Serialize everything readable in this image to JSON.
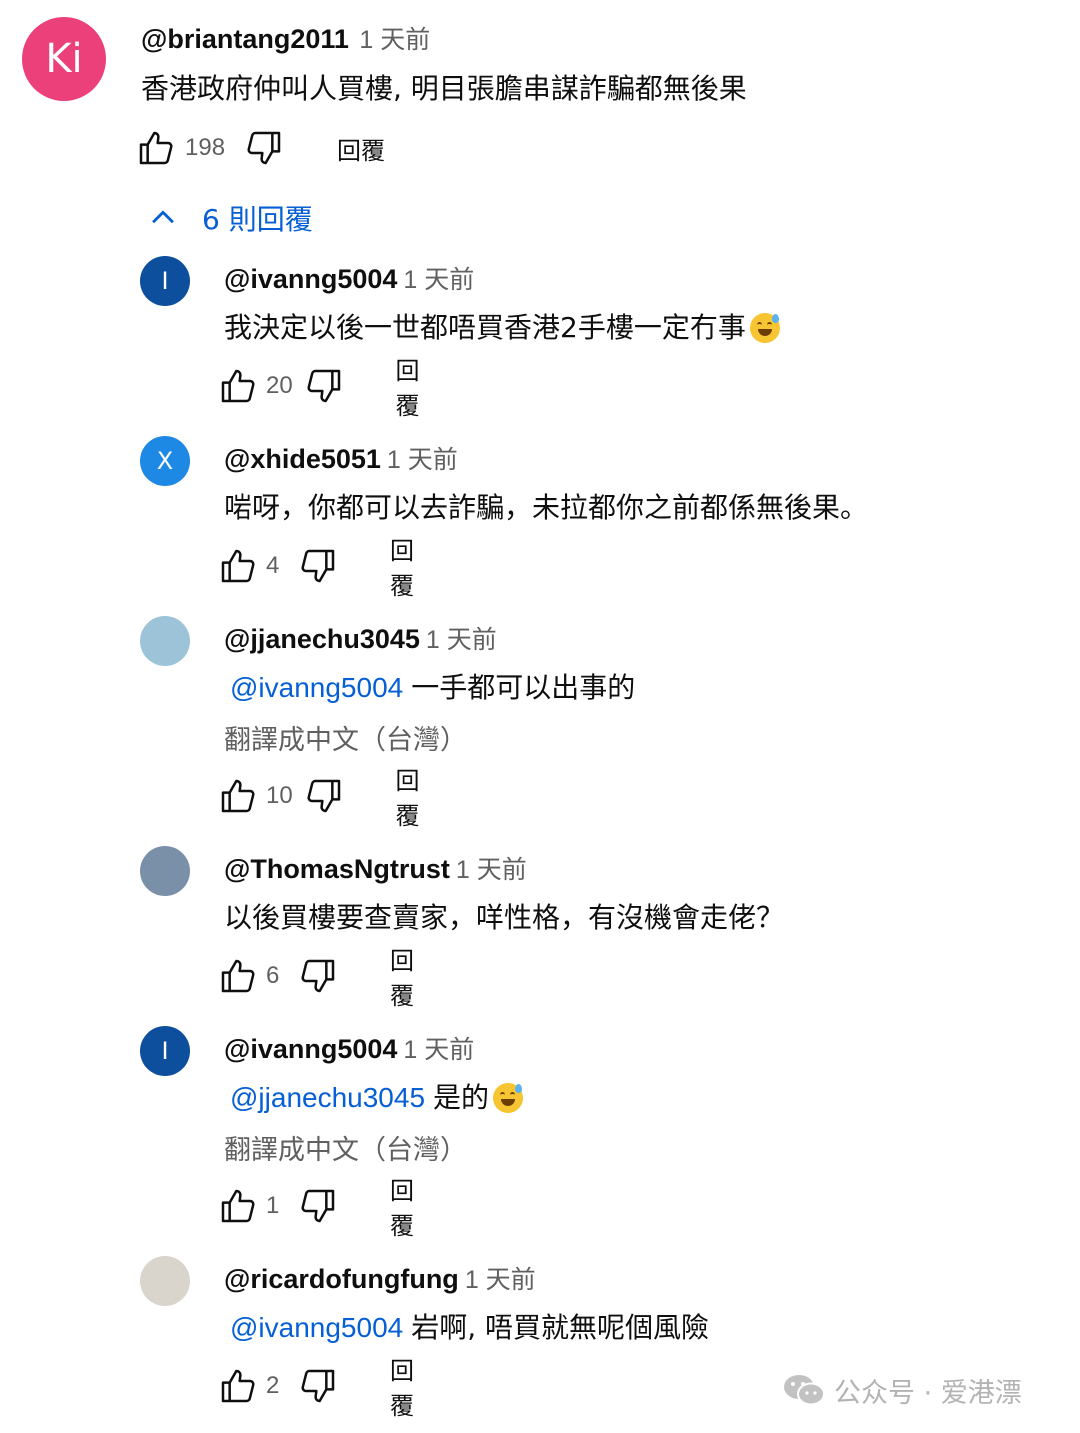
{
  "top_comment": {
    "avatar_text": "Ki",
    "avatar_color": "#ec407a",
    "author": "@briantang2011",
    "time": "1 天前",
    "text": "香港政府仲叫人買樓, 明目張膽串謀詐騙都無後果",
    "likes": "198",
    "reply_label": "回覆"
  },
  "replies_toggle": {
    "label": "6 則回覆",
    "icon": "chevron-up-icon"
  },
  "replies": [
    {
      "avatar_text": "I",
      "avatar_color": "#0d4f9c",
      "author": "@ivanng5004",
      "time": "1 天前",
      "mention": "",
      "text": "我決定以後一世都唔買香港2手樓一定冇事",
      "emoji": "sweat-smile-emoji",
      "translate": "",
      "likes": "20",
      "reply_label": "回覆"
    },
    {
      "avatar_text": "X",
      "avatar_color": "#1e88e5",
      "author": "@xhide5051",
      "time": "1 天前",
      "mention": "",
      "text": "啱呀，你都可以去詐騙，未拉都你之前都係無後果。",
      "emoji": "",
      "translate": "",
      "likes": "4",
      "reply_label": "回覆"
    },
    {
      "avatar_text": "",
      "avatar_color": "#9cc3d8",
      "author": "@jjanechu3045",
      "time": "1 天前",
      "mention": "@ivanng5004",
      "text": "一手都可以出事的",
      "emoji": "",
      "translate": "翻譯成中文（台灣）",
      "likes": "10",
      "reply_label": "回覆"
    },
    {
      "avatar_text": "",
      "avatar_color": "#7a8fa8",
      "author": "@ThomasNgtrust",
      "time": "1 天前",
      "mention": "",
      "text": "以後買樓要查賣家，咩性格，有沒機會走佬？",
      "emoji": "",
      "translate": "",
      "likes": "6",
      "reply_label": "回覆"
    },
    {
      "avatar_text": "I",
      "avatar_color": "#0d4f9c",
      "author": "@ivanng5004",
      "time": "1 天前",
      "mention": "@jjanechu3045",
      "text": "是的",
      "emoji": "sweat-smile-emoji",
      "translate": "翻譯成中文（台灣）",
      "likes": "1",
      "reply_label": "回覆"
    },
    {
      "avatar_text": "",
      "avatar_color": "#d9d4cc",
      "author": "@ricardofungfung",
      "time": "1 天前",
      "mention": "@ivanng5004",
      "text": "岩啊, 唔買就無呢個風險",
      "emoji": "",
      "translate": "",
      "likes": "2",
      "reply_label": "回覆"
    }
  ],
  "watermark": {
    "text": "公众号 · 爱港漂",
    "icon": "wechat-icon"
  }
}
